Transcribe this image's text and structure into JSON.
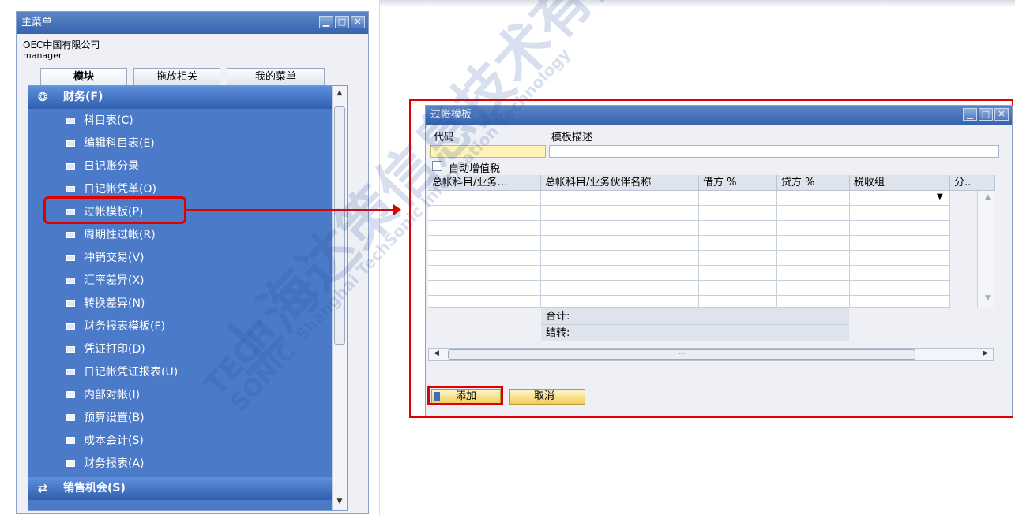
{
  "main_menu": {
    "title": "主菜单",
    "company": "OEC中国有限公司",
    "user": "manager",
    "tabs": [
      "模块",
      "拖放相关",
      "我的菜单"
    ],
    "section_finance": "财务(F)",
    "finance_items": [
      "科目表(C)",
      "编辑科目表(E)",
      "日记账分录",
      "日记帐凭单(O)",
      "过帐模板(P)",
      "周期性过帐(R)",
      "冲销交易(V)",
      "汇率差异(X)",
      "转换差异(N)",
      "财务报表模板(F)",
      "凭证打印(D)",
      "日记帐凭证报表(U)"
    ],
    "finance_folders": [
      "内部对帐(I)",
      "预算设置(B)",
      "成本会计(S)",
      "财务报表(A)"
    ],
    "section_sales": "销售机会(S)"
  },
  "posting_template": {
    "title": "过帐模板",
    "code_label": "代码",
    "desc_label": "模板描述",
    "auto_vat_label": "自动增值税",
    "columns": [
      "总帐科目/业务…",
      "总帐科目/业务伙伴名称",
      "借方 %",
      "贷方 %",
      "税收组",
      "分.."
    ],
    "total_label": "合计:",
    "carry_label": "结转:",
    "add_button": "添加",
    "cancel_button": "取消"
  },
  "watermark": {
    "cn": "上海达策信息技术有限公司",
    "en": "Shanghai TechSonic Information Technology",
    "logo_top": "TECH",
    "logo_bottom": "SONIC"
  },
  "colors": {
    "highlight": "#e10000",
    "menu_blue": "#4b7ac8",
    "title_blue": "#3563ad",
    "button_yellow": "#f2cd58"
  }
}
